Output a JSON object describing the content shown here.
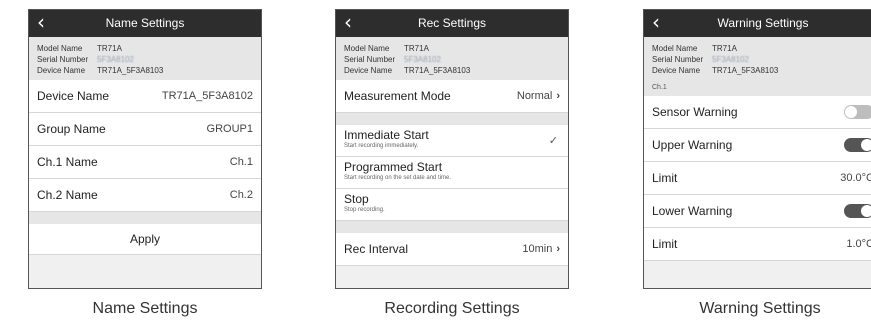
{
  "common_info": {
    "model_label": "Model Name",
    "model_value": "TR71A",
    "serial_label": "Serial Number",
    "serial_value": "5F3A8102",
    "device_label": "Device Name",
    "device_value": "TR71A_5F3A8103"
  },
  "name_settings": {
    "title": "Name Settings",
    "items": [
      {
        "label": "Device Name",
        "value": "TR71A_5F3A8102"
      },
      {
        "label": "Group Name",
        "value": "GROUP1"
      },
      {
        "label": "Ch.1 Name",
        "value": "Ch.1"
      },
      {
        "label": "Ch.2 Name",
        "value": "Ch.2"
      }
    ],
    "apply_label": "Apply",
    "caption": "Name Settings"
  },
  "rec_settings": {
    "title": "Rec Settings",
    "measurement_label": "Measurement Mode",
    "measurement_value": "Normal",
    "modes": [
      {
        "title": "Immediate Start",
        "desc": "Start recording immediately.",
        "selected": true
      },
      {
        "title": "Programmed Start",
        "desc": "Start recording on the set date and time.",
        "selected": false
      },
      {
        "title": "Stop",
        "desc": "Stop recording.",
        "selected": false
      }
    ],
    "interval_label": "Rec Interval",
    "interval_value": "10min",
    "caption": "Recording Settings"
  },
  "warning_settings": {
    "title": "Warning Settings",
    "channel_label": "Ch.1",
    "sensor_warning_label": "Sensor Warning",
    "sensor_warning_on": false,
    "upper_warning_label": "Upper Warning",
    "upper_warning_on": true,
    "upper_limit_label": "Limit",
    "upper_limit_value": "30.0°C",
    "lower_warning_label": "Lower Warning",
    "lower_warning_on": true,
    "lower_limit_label": "Limit",
    "lower_limit_value": "1.0°C",
    "caption": "Warning Settings"
  },
  "icons": {
    "back": "chevron-left-icon",
    "forward": "chevron-right-icon",
    "check": "checkmark-icon"
  }
}
